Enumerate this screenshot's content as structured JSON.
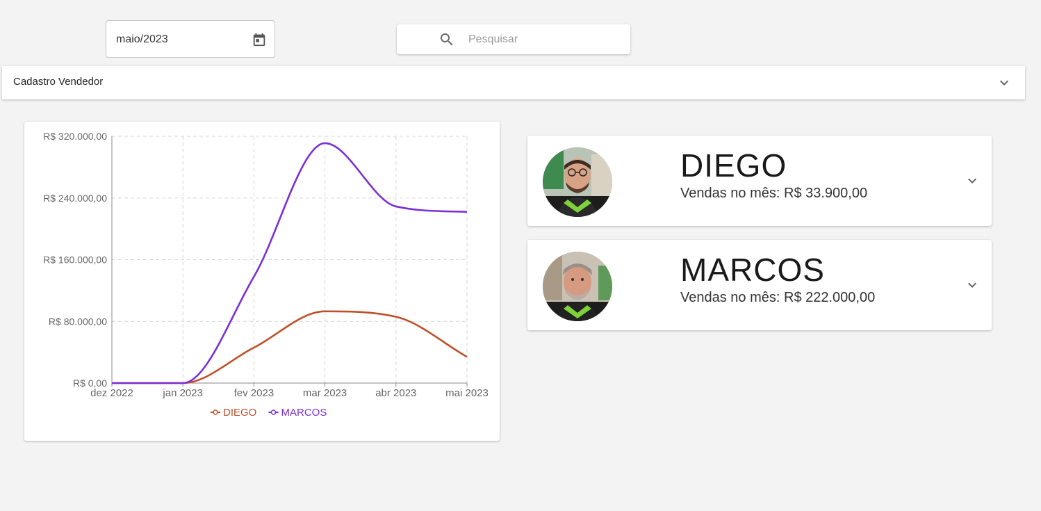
{
  "filters": {
    "month_value": "maio/2023",
    "search_placeholder": "Pesquisar"
  },
  "section": {
    "label": "Cadastro Vendedor"
  },
  "icons": {
    "calendar": "calendar-icon",
    "search": "search-icon",
    "expand": "chevron-down-icon"
  },
  "colors": {
    "diego": "#c0502a",
    "marcos": "#7b2fd6",
    "background": "#f3f3f3"
  },
  "chart_data": {
    "type": "line",
    "categories": [
      "dez 2022",
      "jan 2023",
      "fev 2023",
      "mar 2023",
      "abr 2023",
      "mai 2023"
    ],
    "y_ticks": [
      "R$ 0,00",
      "R$ 80.000,00",
      "R$ 160.000,00",
      "R$ 240.000,00",
      "R$ 320.000,00"
    ],
    "ylim": [
      0,
      320000
    ],
    "grid": true,
    "legend_position": "bottom",
    "series": [
      {
        "name": "DIEGO",
        "color": "#c0502a",
        "values": [
          0,
          0,
          46000,
          93000,
          86000,
          34000
        ]
      },
      {
        "name": "MARCOS",
        "color": "#7b2fd6",
        "values": [
          0,
          0,
          138000,
          311000,
          229000,
          222000
        ]
      }
    ]
  },
  "sellers": [
    {
      "name": "DIEGO",
      "sales_label": "Vendas no mês:",
      "sales_value": "R$ 33.900,00"
    },
    {
      "name": "MARCOS",
      "sales_label": "Vendas no mês:",
      "sales_value": "R$ 222.000,00"
    }
  ]
}
